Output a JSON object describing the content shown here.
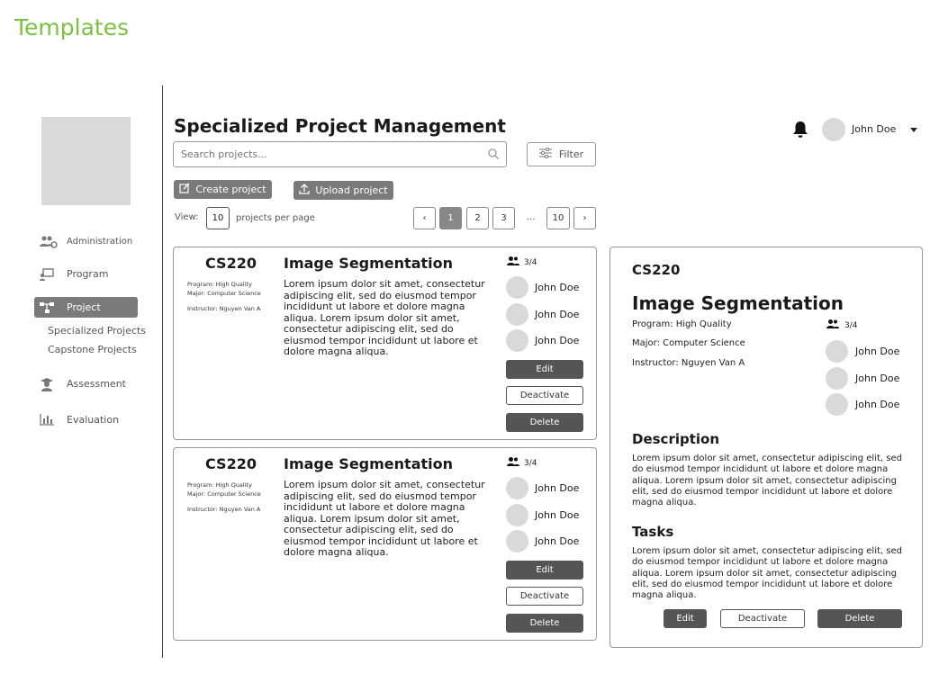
{
  "page_label": "Templates",
  "sidebar": {
    "items": [
      {
        "label": "Administration",
        "icon": "users-gear-icon"
      },
      {
        "label": "Program",
        "icon": "presentation-icon"
      },
      {
        "label": "Project",
        "icon": "network-icon"
      },
      {
        "label": "Assessment",
        "icon": "graduate-icon"
      },
      {
        "label": "Evaluation",
        "icon": "bar-chart-icon"
      }
    ],
    "subitems": [
      "Specialized Projects",
      "Capstone Projects"
    ],
    "active": "Project"
  },
  "header": {
    "title": "Specialized Project Management",
    "search_placeholder": "Search projects...",
    "filter_label": "Filter",
    "create_label": "Create project",
    "upload_label": "Upload project",
    "user_name": "John Doe"
  },
  "view": {
    "label": "View:",
    "per_page_value": "10",
    "per_page_label": "projects per page"
  },
  "pagination": {
    "prev": "‹",
    "pages": [
      "1",
      "2",
      "3"
    ],
    "dots": "...",
    "last": "10",
    "next": "›",
    "current": "1"
  },
  "cards": [
    {
      "code": "CS220",
      "program": "Program: High Quality",
      "major": "Major: Computer Science",
      "instructor": "Instructor: Nguyen Van A",
      "title": "Image Segmentation",
      "description": "Lorem ipsum dolor sit amet, consectetur adipiscing elit, sed do eiusmod tempor incididunt ut labore et dolore magna aliqua. Lorem ipsum dolor sit amet, consectetur adipiscing elit, sed do eiusmod tempor incididunt ut labore et dolore magna aliqua.",
      "member_count": "3/4",
      "members": [
        "John Doe",
        "John Doe",
        "John Doe"
      ],
      "edit": "Edit",
      "deactivate": "Deactivate",
      "delete": "Delete"
    },
    {
      "code": "CS220",
      "program": "Program: High Quality",
      "major": "Major: Computer Science",
      "instructor": "Instructor: Nguyen Van A",
      "title": "Image Segmentation",
      "description": "Lorem ipsum dolor sit amet, consectetur adipiscing elit, sed do eiusmod tempor incididunt ut labore et dolore magna aliqua. Lorem ipsum dolor sit amet, consectetur adipiscing elit, sed do eiusmod tempor incididunt ut labore et dolore magna aliqua.",
      "member_count": "3/4",
      "members": [
        "John Doe",
        "John Doe",
        "John Doe"
      ],
      "edit": "Edit",
      "deactivate": "Deactivate",
      "delete": "Delete"
    }
  ],
  "detail": {
    "code": "CS220",
    "title": "Image Segmentation",
    "program": "Program: High Quality",
    "major": "Major: Computer Science",
    "instructor": "Instructor: Nguyen Van A",
    "member_count": "3/4",
    "members": [
      "John Doe",
      "John Doe",
      "John Doe"
    ],
    "description_heading": "Description",
    "description": "Lorem ipsum dolor sit amet, consectetur adipiscing elit, sed do eiusmod tempor incididunt ut labore et dolore magna aliqua. Lorem ipsum dolor sit amet, consectetur adipiscing elit, sed do eiusmod tempor incididunt ut labore et dolore magna aliqua.",
    "tasks_heading": "Tasks",
    "tasks": "Lorem ipsum dolor sit amet, consectetur adipiscing elit, sed do eiusmod tempor incididunt ut labore et dolore magna aliqua. Lorem ipsum dolor sit amet, consectetur adipiscing elit, sed do eiusmod tempor incididunt ut labore et dolore magna aliqua.",
    "edit": "Edit",
    "deactivate": "Deactivate",
    "delete": "Delete"
  },
  "colors": {
    "accent_green": "#7cc242",
    "active_nav": "#7a7a7a",
    "dark_button": "#555555",
    "placeholder_gray": "#d9d9d9"
  }
}
